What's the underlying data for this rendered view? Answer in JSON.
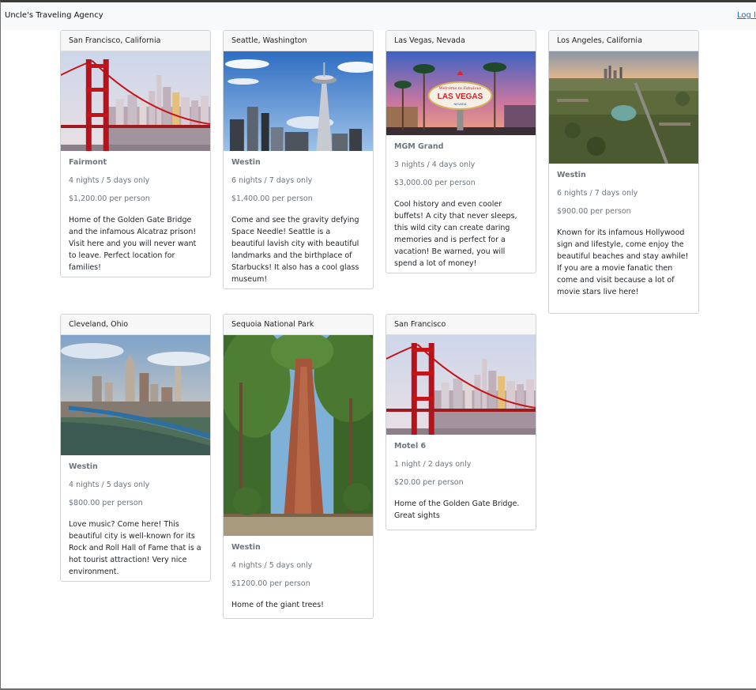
{
  "navbar": {
    "brand": "Uncle's Traveling Agency",
    "login": "Log In"
  },
  "cards": [
    {
      "header": "San Francisco, California",
      "hotel": "Fairmont",
      "duration": "4 nights / 5 days only",
      "price": "$1,200.00 per person",
      "description": "Home of the Golden Gate Bridge and the infamous Alcatraz prison! Visit here and you will never want to leave. Perfect location for families!",
      "image": "golden-gate-bridge-photo"
    },
    {
      "header": "Seattle, Washington",
      "hotel": "Westin",
      "duration": "6 nights / 7 days only",
      "price": "$1,400.00 per person",
      "description": "Come and see the gravity defying Space Needle! Seattle is a beautiful lavish city with beautiful landmarks and the birthplace of Starbucks! It also has a cool glass museum!",
      "image": "space-needle-photo"
    },
    {
      "header": "Las Vegas, Nevada",
      "hotel": "MGM Grand",
      "duration": "3 nights / 4 days only",
      "price": "$3,000.00 per person",
      "description": "Cool history and even cooler buffets! A city that never sleeps, this wild city can create daring memories and is perfect for a vacation! Be warned, you will spend a lot of money!",
      "image": "las-vegas-sign-photo",
      "sign_top": "Welcome to Fabulous",
      "sign_main": "LAS VEGAS",
      "sign_bottom": "NEVADA"
    },
    {
      "header": "Los Angeles, California",
      "hotel": "Westin",
      "duration": "6 nights / 7 days only",
      "price": "$900.00 per person",
      "description": "Known for its infamous Hollywood sign and lifestyle, come enjoy the beautiful beaches and stay awhile! If you are a movie fanatic then come and visit because a lot of movie stars live here!",
      "image": "los-angeles-aerial-photo"
    },
    {
      "header": "Cleveland, Ohio",
      "hotel": "Westin",
      "duration": "4 nights / 5 days only",
      "price": "$800.00 per person",
      "description": "Love music? Come here! This beautiful city is well-known for its Rock and Roll Hall of Fame that is a hot tourist attraction! Very nice environment.",
      "image": "cleveland-skyline-photo"
    },
    {
      "header": "Sequoia National Park",
      "hotel": "Westin",
      "duration": "4 nights / 5 days only",
      "price": "$1200.00 per person",
      "description": "Home of the giant trees!",
      "image": "sequoia-tree-photo"
    },
    {
      "header": "San Francisco",
      "hotel": "Motel 6",
      "duration": "1 night / 2 days only",
      "price": "$20.00 per person",
      "description": "Home of the Golden Gate Bridge. Great sights",
      "image": "golden-gate-bridge-photo"
    }
  ],
  "colors": {
    "navbar_bg": "#f8f9fa",
    "link": "#0d6efd",
    "card_border": "#cfd2d5",
    "muted_text": "#6c757d"
  }
}
